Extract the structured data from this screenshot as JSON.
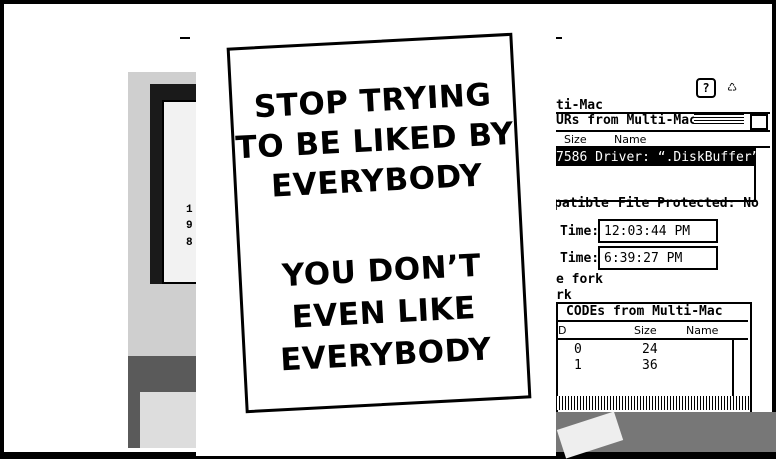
{
  "poster": {
    "lines_top": [
      "STOP TRYING",
      "TO BE LIKED BY",
      "EVERYBODY"
    ],
    "lines_bottom": [
      "YOU DON’T",
      "EVEN LIKE",
      "EVERYBODY"
    ]
  },
  "mac": {
    "window_title": "ti-Mac",
    "list_title": "URs from Multi-Mac",
    "col_size": "Size",
    "col_name": "Name",
    "selected_row": "7586  Driver: “.DiskBuffer”",
    "compatible_label": "patible",
    "file_protected_label": "File Protected: No",
    "time_label_1": "Time:",
    "time_value_1": "12:03:44 PM",
    "time_label_2": "Time:",
    "time_value_2": "6:39:27 PM",
    "fork_1": "e fork",
    "fork_2": "rk",
    "codes_title": "CODEs from Multi-Mac",
    "codes_col_id": "D",
    "codes_col_size": "Size",
    "codes_col_name": "Name",
    "codes_rows": [
      {
        "id": "0",
        "size": "24"
      },
      {
        "id": "1",
        "size": "36"
      }
    ],
    "help_icon_glyph": "?",
    "icons": [
      "help-icon",
      "trash-icon"
    ]
  },
  "left_numbers": [
    "1",
    "9",
    "8"
  ]
}
